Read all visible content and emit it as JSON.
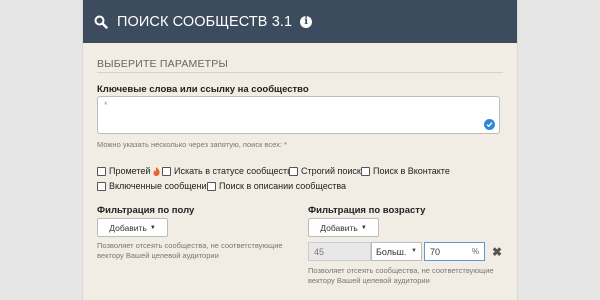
{
  "header": {
    "title": "ПОИСК СООБЩЕСТВ 3.1",
    "info_icon": "i"
  },
  "params": {
    "title": "ВЫБЕРИТЕ ПАРАМЕТРЫ"
  },
  "keywords": {
    "label": "Ключевые слова или ссылку на сообщество",
    "placeholder": "*",
    "hint": "Можно указать несколько через запятую, поиск всех: *"
  },
  "checkboxes": [
    {
      "label": "Прометей",
      "checked": false
    },
    {
      "label": "Искать в статусе сообщества",
      "checked": false
    },
    {
      "label": "Строгий поиск",
      "checked": false
    },
    {
      "label": "Поиск в Вконтакте",
      "checked": false
    },
    {
      "label": "Включенные сообщения",
      "checked": false
    },
    {
      "label": "Поиск в описании сообщества",
      "checked": false
    }
  ],
  "gender_filter": {
    "label": "Фильтрация по полу",
    "add_button": "Добавить",
    "hint_line1": "Позволяет отсеять сообщества, не соответствующие",
    "hint_line2": "вектору Вашей целевой аудитории"
  },
  "age_filter": {
    "label": "Фильтрация по возрасту",
    "add_button": "Добавить",
    "age_value": "45",
    "compare": "Больш.",
    "percent_value": "70",
    "percent_unit": "%",
    "remove_symbol": "✖",
    "hint_line1": "Позволяет отсеять сообщества, не соответствующие",
    "hint_line2": "вектору Вашей целевой аудитории"
  },
  "colors": {
    "header_bg": "#3c4b5e",
    "panel_bg": "#f1ece4",
    "accent": "#2e88d8",
    "fire": "#e8642c"
  }
}
